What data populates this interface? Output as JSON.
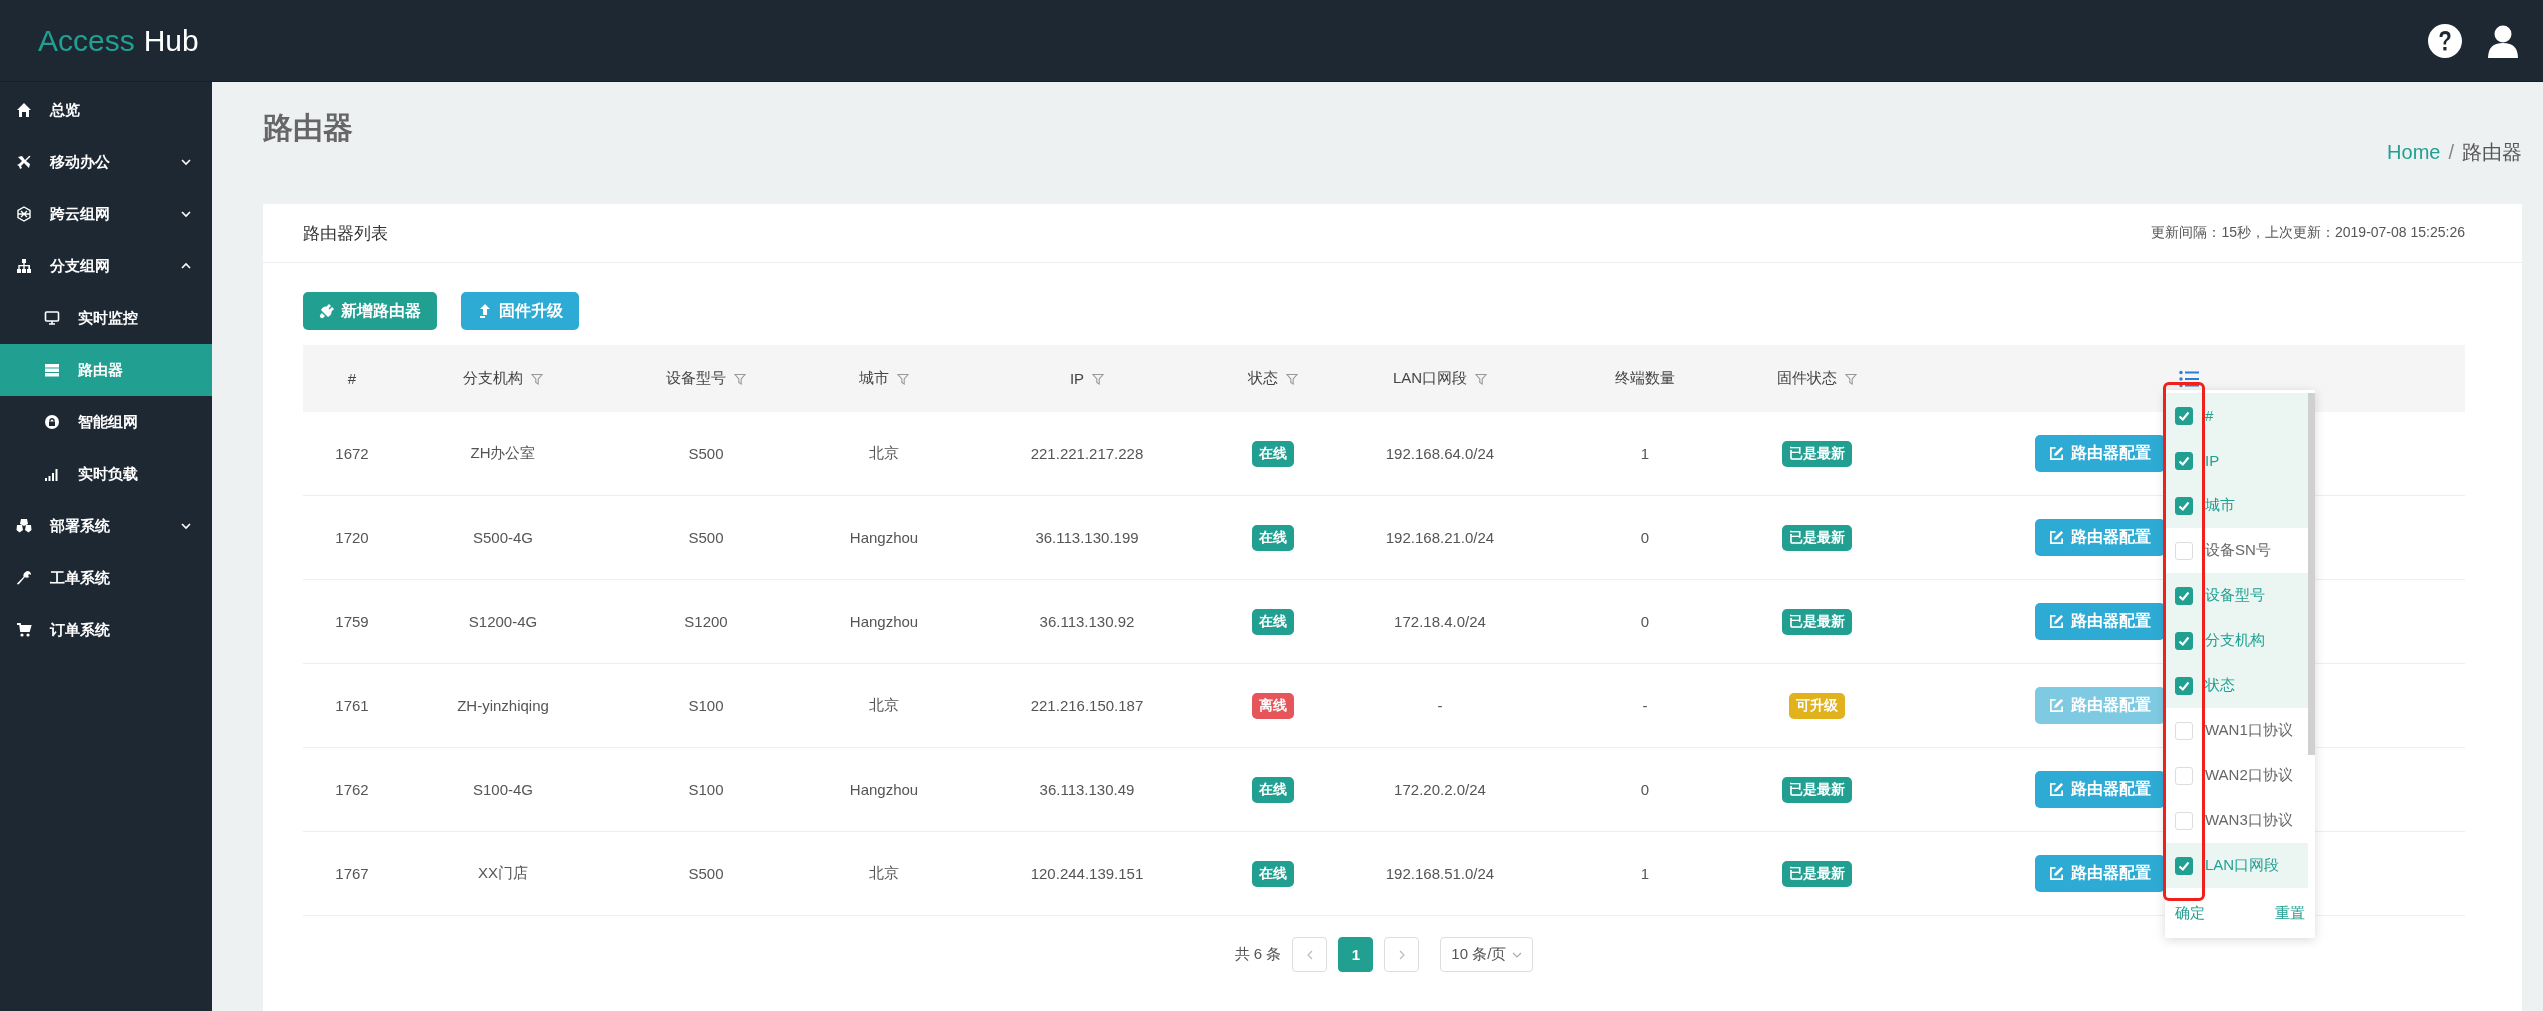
{
  "header": {
    "logo": {
      "part_1": "Access",
      "part_2": "Hub"
    }
  },
  "sidebar": {
    "items": [
      {
        "label": "总览",
        "selected": false
      },
      {
        "label": "移动办公",
        "selected": false,
        "expanded": false
      },
      {
        "label": "跨云组网",
        "selected": false,
        "expanded": false
      },
      {
        "label": "分支组网",
        "selected": false,
        "expanded": true,
        "children": [
          {
            "label": "实时监控",
            "selected": false
          },
          {
            "label": "路由器",
            "selected": true
          },
          {
            "label": "智能组网",
            "selected": false
          },
          {
            "label": "实时负载",
            "selected": false
          }
        ]
      },
      {
        "label": "部署系统",
        "selected": false,
        "expanded": false
      },
      {
        "label": "工单系统",
        "selected": false
      },
      {
        "label": "订单系统",
        "selected": false
      }
    ]
  },
  "page": {
    "title": "路由器",
    "breadcrumb": [
      {
        "label": "Home",
        "kind": "link"
      },
      {
        "label": "路由器",
        "kind": "current"
      }
    ],
    "separator": "/"
  },
  "card": {
    "title": "路由器列表",
    "meta": "更新间隔：15秒，上次更新：2019-07-08 15:25:26",
    "buttons": [
      {
        "label": "新增路由器",
        "kind": "primary"
      },
      {
        "label": "固件升级",
        "kind": "info"
      }
    ]
  },
  "table": {
    "columns": [
      {
        "label": "#",
        "filter": false
      },
      {
        "label": "分支机构",
        "filter": true
      },
      {
        "label": "设备型号",
        "filter": true
      },
      {
        "label": "城市",
        "filter": true
      },
      {
        "label": "IP",
        "filter": true
      },
      {
        "label": "状态",
        "filter": true
      },
      {
        "label": "LAN口网段",
        "filter": true
      },
      {
        "label": "终端数量",
        "filter": false
      },
      {
        "label": "固件状态",
        "filter": true
      }
    ],
    "rows": [
      {
        "id": "1672",
        "branch": "ZH办公室",
        "model": "S500",
        "city": "北京",
        "ip": "221.221.217.228",
        "status": {
          "label": "在线",
          "kind": "online"
        },
        "lan": "192.168.64.0/24",
        "terminals": "1",
        "firmware": {
          "label": "已是最新",
          "kind": "latest"
        },
        "action": {
          "label": "路由器配置",
          "disabled": false
        }
      },
      {
        "id": "1720",
        "branch": "S500-4G",
        "model": "S500",
        "city": "Hangzhou",
        "ip": "36.113.130.199",
        "status": {
          "label": "在线",
          "kind": "online"
        },
        "lan": "192.168.21.0/24",
        "terminals": "0",
        "firmware": {
          "label": "已是最新",
          "kind": "latest"
        },
        "action": {
          "label": "路由器配置",
          "disabled": false
        }
      },
      {
        "id": "1759",
        "branch": "S1200-4G",
        "model": "S1200",
        "city": "Hangzhou",
        "ip": "36.113.130.92",
        "status": {
          "label": "在线",
          "kind": "online"
        },
        "lan": "172.18.4.0/24",
        "terminals": "0",
        "firmware": {
          "label": "已是最新",
          "kind": "latest"
        },
        "action": {
          "label": "路由器配置",
          "disabled": false
        }
      },
      {
        "id": "1761",
        "branch": "ZH-yinzhiqing",
        "model": "S100",
        "city": "北京",
        "ip": "221.216.150.187",
        "status": {
          "label": "离线",
          "kind": "offline"
        },
        "lan": "-",
        "terminals": "-",
        "firmware": {
          "label": "可升级",
          "kind": "upgradable"
        },
        "action": {
          "label": "路由器配置",
          "disabled": true
        }
      },
      {
        "id": "1762",
        "branch": "S100-4G",
        "model": "S100",
        "city": "Hangzhou",
        "ip": "36.113.130.49",
        "status": {
          "label": "在线",
          "kind": "online"
        },
        "lan": "172.20.2.0/24",
        "terminals": "0",
        "firmware": {
          "label": "已是最新",
          "kind": "latest"
        },
        "action": {
          "label": "路由器配置",
          "disabled": false
        }
      },
      {
        "id": "1767",
        "branch": "XX门店",
        "model": "S500",
        "city": "北京",
        "ip": "120.244.139.151",
        "status": {
          "label": "在线",
          "kind": "online"
        },
        "lan": "192.168.51.0/24",
        "terminals": "1",
        "firmware": {
          "label": "已是最新",
          "kind": "latest"
        },
        "action": {
          "label": "路由器配置",
          "disabled": false
        }
      }
    ]
  },
  "column_picker": {
    "highlighted": true,
    "options": [
      {
        "label": "#",
        "checked": true
      },
      {
        "label": "IP",
        "checked": true
      },
      {
        "label": "城市",
        "checked": true
      },
      {
        "label": "设备SN号",
        "checked": false
      },
      {
        "label": "设备型号",
        "checked": true
      },
      {
        "label": "分支机构",
        "checked": true
      },
      {
        "label": "状态",
        "checked": true
      },
      {
        "label": "WAN1口协议",
        "checked": false
      },
      {
        "label": "WAN2口协议",
        "checked": false
      },
      {
        "label": "WAN3口协议",
        "checked": false
      },
      {
        "label": "LAN口网段",
        "checked": true
      }
    ],
    "confirm": "确定",
    "reset": "重置"
  },
  "pagination": {
    "total": "共 6 条",
    "pages": [
      {
        "label": "1",
        "selected": true
      }
    ],
    "page_size": "10 条/页"
  }
}
